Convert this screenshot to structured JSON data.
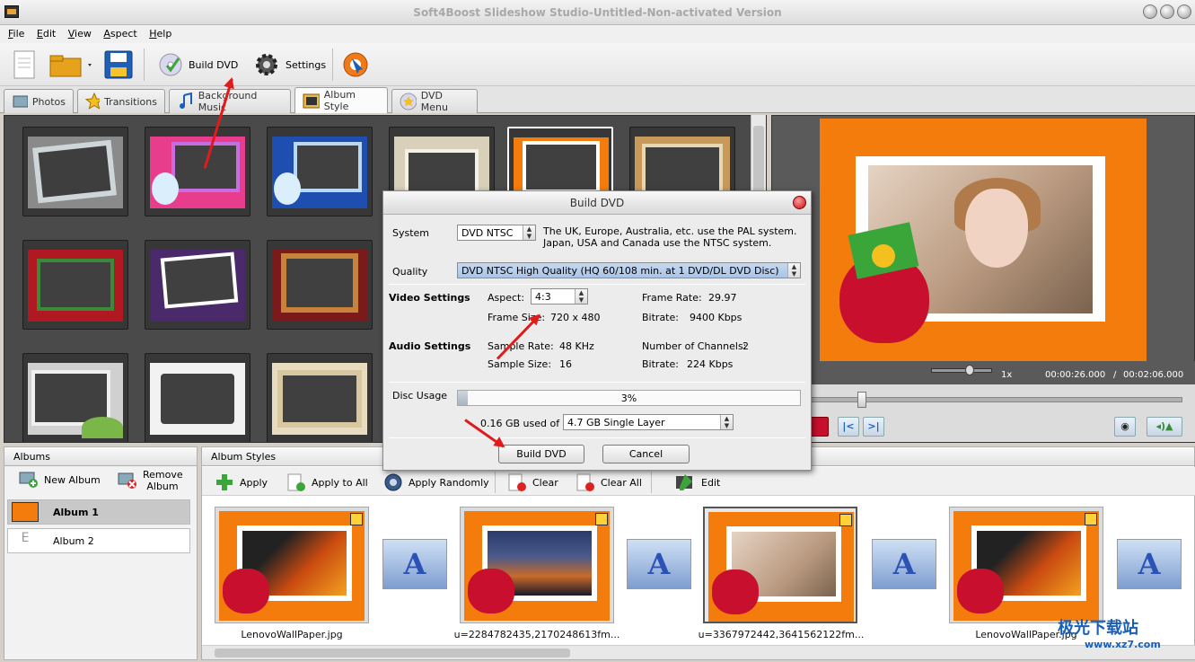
{
  "window": {
    "title": "Soft4Boost Slideshow Studio-Untitled-Non-activated Version"
  },
  "menu": [
    "File",
    "Edit",
    "View",
    "Aspect",
    "Help"
  ],
  "toolbar": {
    "build_dvd": "Build DVD",
    "settings": "Settings"
  },
  "tabs": [
    "Photos",
    "Transitions",
    "Background Music",
    "Album Style",
    "DVD Menu"
  ],
  "active_tab": "Album Style",
  "player": {
    "speed": "1x",
    "time_current": "00:00:26.000",
    "time_sep": "/",
    "time_total": "00:02:06.000"
  },
  "albums_panel": {
    "header": "Albums",
    "new_album": "New Album",
    "remove_album": "Remove Album",
    "items": [
      "Album 1",
      "Album 2"
    ],
    "selected": "Album 1"
  },
  "styles_panel": {
    "header": "Album Styles",
    "apply": "Apply",
    "apply_all": "Apply to All",
    "apply_randomly": "Apply Randomly",
    "clear": "Clear",
    "clear_all": "Clear All",
    "edit": "Edit",
    "slides": [
      "LenovoWallPaper.jpg",
      "u=2284782435,2170248613fm...",
      "u=3367972442,3641562122fm...",
      "LenovoWallPaper.jpg"
    ]
  },
  "dialog": {
    "title": "Build DVD",
    "system_label": "System",
    "system_value": "DVD NTSC",
    "system_note": "The UK, Europe, Australia, etc. use the PAL system. Japan, USA and Canada use the NTSC system.",
    "quality_label": "Quality",
    "quality_value": "DVD NTSC High Quality (HQ 60/108 min. at 1 DVD/DL DVD Disc)",
    "video_settings": "Video Settings",
    "aspect_label": "Aspect:",
    "aspect_value": "4:3",
    "frame_size_label": "Frame Size:",
    "frame_size_value": "720 x 480",
    "frame_rate_label": "Frame Rate:",
    "frame_rate_value": "29.97",
    "video_bitrate_label": "Bitrate:",
    "video_bitrate_value": "9400 Kbps",
    "audio_settings": "Audio Settings",
    "sample_rate_label": "Sample Rate:",
    "sample_rate_value": "48 KHz",
    "sample_size_label": "Sample Size:",
    "sample_size_value": "16",
    "channels_label": "Number of Channels:",
    "channels_value": "2",
    "audio_bitrate_label": "Bitrate:",
    "audio_bitrate_value": "224 Kbps",
    "disc_usage_label": "Disc Usage",
    "disc_usage_percent": "3%",
    "disc_usage_fraction": 0.03,
    "used_of": "0.16 GB used of",
    "disc_type": "4.7 GB Single Layer",
    "build_button": "Build DVD",
    "cancel_button": "Cancel"
  },
  "watermark": {
    "brand": "极光下载站",
    "url": "www.xz7.com"
  },
  "colors": {
    "accent_orange": "#f47c0c",
    "arrow_red": "#e01b1b",
    "bag_red": "#c8102e"
  }
}
